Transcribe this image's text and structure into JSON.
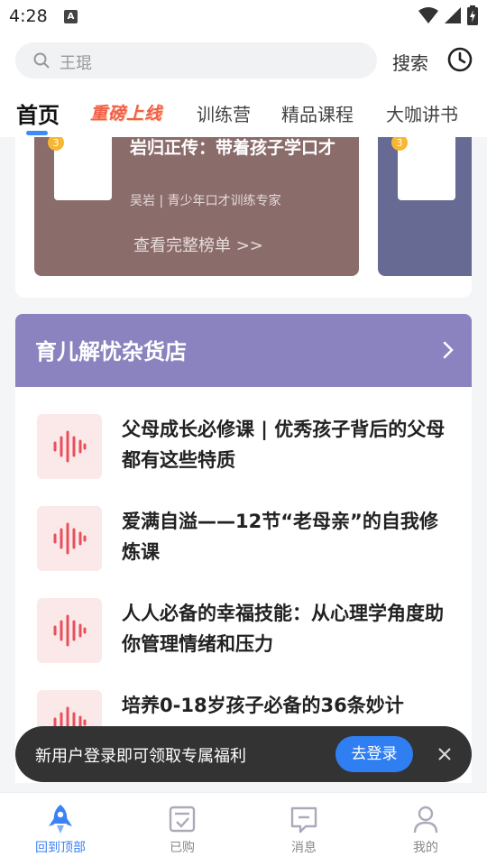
{
  "status_bar": {
    "time": "4:28",
    "notification_glyph": "A"
  },
  "search": {
    "placeholder": "王琨",
    "button_label": "搜索"
  },
  "tabs": [
    {
      "label": "首页",
      "active": true
    },
    {
      "label": "重磅上线",
      "promo": true
    },
    {
      "label": "训练营"
    },
    {
      "label": "精品课程"
    },
    {
      "label": "大咖讲书"
    }
  ],
  "ranking": {
    "main": {
      "title": "岩归正传：带着孩子学口才",
      "author": "吴岩 | 青少年口才训练专家",
      "more_label": "查看完整榜单 >>",
      "color": "#8a6c6b"
    },
    "side_color": "#676a92"
  },
  "store": {
    "title": "育儿解忧杂货店",
    "header_color": "#8a83bf",
    "items": [
      {
        "title": "父母成长必修课 | 优秀孩子背后的父母都有这些特质"
      },
      {
        "title": "爱满自溢——12节“老母亲”的自我修炼课"
      },
      {
        "title": "人人必备的幸福技能：从心理学角度助你管理情绪和压力"
      },
      {
        "title": "培养0-18岁孩子必备的36条妙计"
      }
    ]
  },
  "toast": {
    "text": "新用户登录即可领取专属福利",
    "button_label": "去登录"
  },
  "bottom_nav": [
    {
      "label": "回到顶部",
      "icon": "rocket-icon",
      "active": true
    },
    {
      "label": "已购",
      "icon": "purchased-icon"
    },
    {
      "label": "消息",
      "icon": "message-icon"
    },
    {
      "label": "我的",
      "icon": "profile-icon"
    }
  ],
  "colors": {
    "accent": "#3b82f6",
    "audio_icon": "#e8505b"
  }
}
